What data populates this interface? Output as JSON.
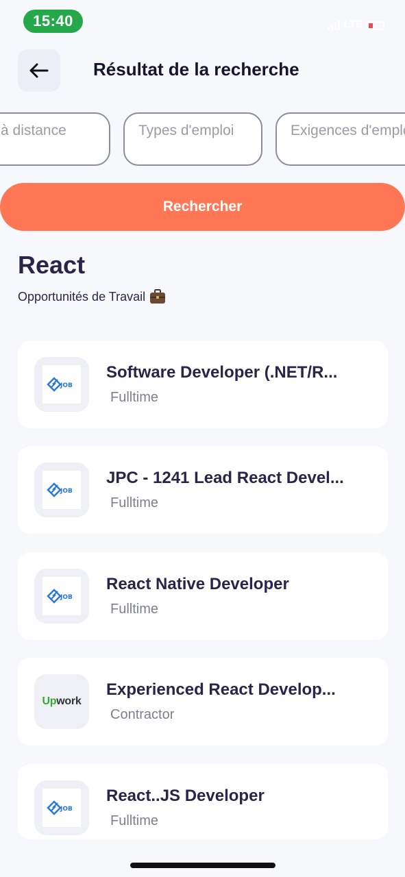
{
  "status_bar": {
    "time": "15:40",
    "network": "LTE"
  },
  "header": {
    "title": "Résultat de la recherche"
  },
  "filters": [
    {
      "label": "Emploi à distance"
    },
    {
      "label": "Types d'emploi"
    },
    {
      "label": "Exigences d'emploi"
    }
  ],
  "search_button": {
    "label": "Rechercher"
  },
  "results": {
    "query": "React",
    "subtitle": "Opportunités de Travail"
  },
  "jobs": [
    {
      "title": "Software Developer (.NET/R...",
      "type": "Fulltime",
      "logo": "job-logo"
    },
    {
      "title": "JPC - 1241 Lead React Devel...",
      "type": "Fulltime",
      "logo": "job-logo"
    },
    {
      "title": "React Native Developer",
      "type": "Fulltime",
      "logo": "job-logo"
    },
    {
      "title": "Experienced React Develop...",
      "type": "Contractor",
      "logo": "upwork-logo"
    },
    {
      "title": "React..JS Developer",
      "type": "Fulltime",
      "logo": "job-logo"
    }
  ],
  "logos": {
    "job_text": "JOB",
    "upwork_up": "Up",
    "upwork_rest": "work"
  },
  "colors": {
    "accent": "#ff7755",
    "time_pill": "#25a84a",
    "text_primary": "#2a2548",
    "text_secondary": "#7d7f8c",
    "job_logo_blue": "#2a78d6"
  }
}
